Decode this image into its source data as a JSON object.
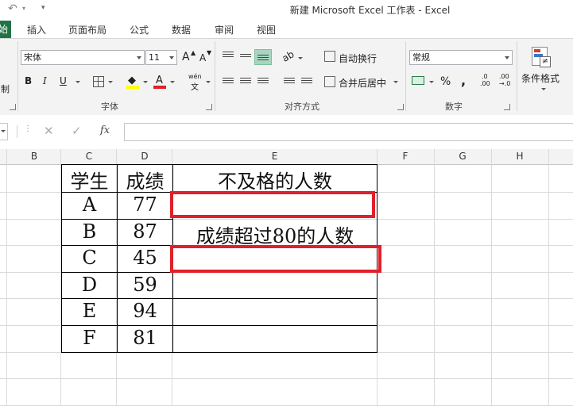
{
  "window": {
    "title": "新建 Microsoft Excel 工作表 - Excel"
  },
  "tabs": {
    "home": "始",
    "insert": "插入",
    "layout": "页面布局",
    "formulas": "公式",
    "data": "数据",
    "review": "审阅",
    "view": "视图"
  },
  "ribbon": {
    "clipboard_partial": "制",
    "font_name": "宋体",
    "font_size": "11",
    "grow_font": "A",
    "shrink_font": "A",
    "bold": "B",
    "italic": "I",
    "underline": "U",
    "font_color_letter": "A",
    "phonetic": "wén",
    "phonetic_sub": "文",
    "font_group": "字体",
    "wrap_text": "自动换行",
    "merge_center": "合并后居中",
    "alignment_group": "对齐方式",
    "number_format": "常规",
    "percent": "%",
    "comma": ",",
    "inc_decimal_top": ".0",
    "inc_decimal_bottom": ".00",
    "dec_decimal_top": ".00",
    "dec_decimal_bottom": "→.0",
    "number_group": "数字",
    "cond_format": "条件格式"
  },
  "formula_bar": {
    "fx": "fx",
    "value": ""
  },
  "columns": [
    "B",
    "C",
    "D",
    "E",
    "F",
    "G",
    "H"
  ],
  "table": {
    "header": {
      "student": "学生",
      "score": "成绩",
      "fail_count": "不及格的人数"
    },
    "over80_label": "成绩超过80的人数",
    "rows": [
      {
        "student": "A",
        "score": "77"
      },
      {
        "student": "B",
        "score": "87"
      },
      {
        "student": "C",
        "score": "45"
      },
      {
        "student": "D",
        "score": "59"
      },
      {
        "student": "E",
        "score": "94"
      },
      {
        "student": "F",
        "score": "81"
      }
    ]
  },
  "colors": {
    "excel_green": "#217346",
    "highlight_red": "#e0202a",
    "fill_yellow": "#ffff00",
    "font_red": "#e0202a"
  }
}
